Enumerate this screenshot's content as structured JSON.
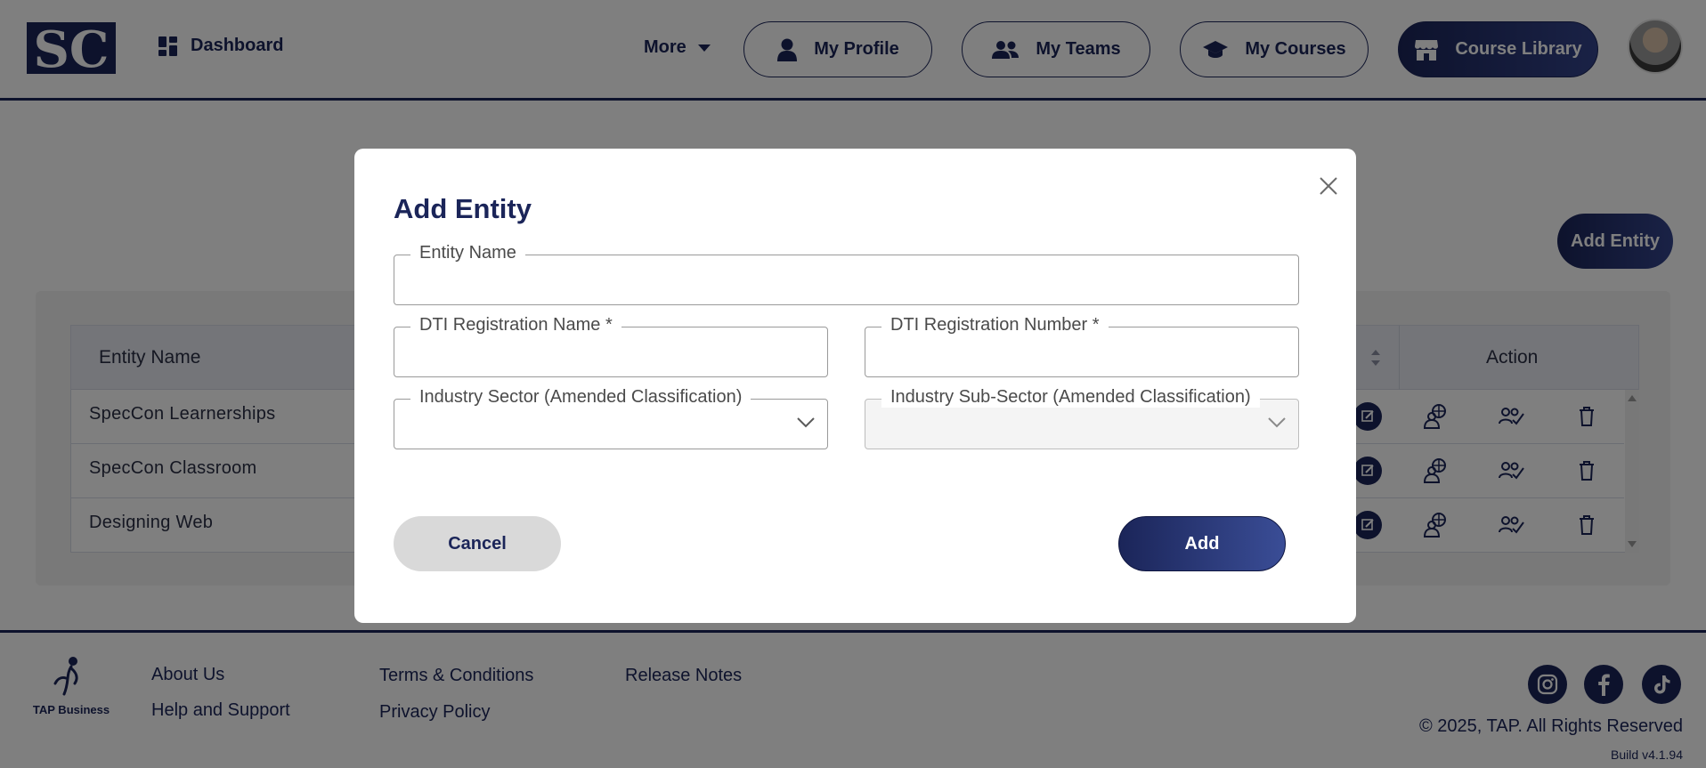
{
  "header": {
    "logo_text": "SC",
    "nav": {
      "dashboard": "Dashboard",
      "more": "More",
      "my_profile": "My Profile",
      "my_teams": "My Teams",
      "my_courses": "My Courses",
      "course_library": "Course Library"
    }
  },
  "page": {
    "add_entity_button": "Add Entity",
    "table": {
      "headers": {
        "entity_name": "Entity Name",
        "action": "Action"
      },
      "rows": [
        {
          "entity_name": "SpecCon Learnerships"
        },
        {
          "entity_name": "SpecCon Classroom"
        },
        {
          "entity_name": "Designing Web"
        }
      ]
    }
  },
  "modal": {
    "title": "Add Entity",
    "fields": {
      "entity_name": {
        "label": "Entity Name",
        "value": ""
      },
      "dti_registration_name": {
        "label": "DTI Registration Name *",
        "value": ""
      },
      "dti_registration_number": {
        "label": "DTI Registration Number *",
        "value": ""
      },
      "industry_sector": {
        "label": "Industry Sector (Amended Classification)",
        "value": ""
      },
      "industry_sub_sector": {
        "label": "Industry Sub-Sector (Amended Classification)",
        "value": "",
        "disabled": true
      }
    },
    "cancel_label": "Cancel",
    "add_label": "Add"
  },
  "footer": {
    "logo_text": "TAP Business",
    "links": {
      "about_us": "About Us",
      "help_and_support": "Help and Support",
      "terms": "Terms & Conditions",
      "privacy": "Privacy Policy",
      "release_notes": "Release Notes"
    },
    "social": [
      "instagram-icon",
      "facebook-icon",
      "tiktok-icon"
    ],
    "copyright": "© 2025, TAP. All Rights Reserved",
    "build": "Build v4.1.94"
  },
  "colors": {
    "brand_navy": "#1b2559",
    "overlay": "rgba(0,0,0,0.5)",
    "cancel_bg": "#d9d9d9"
  }
}
